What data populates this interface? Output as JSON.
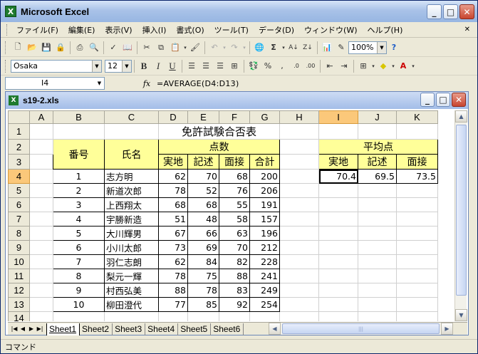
{
  "app": {
    "title": "Microsoft Excel",
    "file_name": "s19-2.xls"
  },
  "menu": {
    "items": [
      "ファイル(F)",
      "編集(E)",
      "表示(V)",
      "挿入(I)",
      "書式(O)",
      "ツール(T)",
      "データ(D)",
      "ウィンドウ(W)",
      "ヘルプ(H)"
    ]
  },
  "toolbar": {
    "zoom": "100%",
    "font_name": "Osaka",
    "font_size": "12"
  },
  "formula_bar": {
    "name_box": "I4",
    "fx_label": "fx",
    "formula": "=AVERAGE(D4:D13)"
  },
  "sheet": {
    "columns": [
      "A",
      "B",
      "C",
      "D",
      "E",
      "F",
      "G",
      "H",
      "I",
      "J",
      "K"
    ],
    "selected_column": "I",
    "selected_row": "4",
    "row_numbers": [
      "1",
      "2",
      "3",
      "4",
      "5",
      "6",
      "7",
      "8",
      "9",
      "10",
      "11",
      "12",
      "13",
      "14"
    ],
    "title": "免許試験合否表",
    "headers": {
      "number": "番号",
      "name": "氏名",
      "points": "点数",
      "practical": "実地",
      "written": "記述",
      "interview": "面接",
      "total": "合計"
    },
    "rows": [
      {
        "no": "1",
        "name": "志方明",
        "practical": "62",
        "written": "70",
        "interview": "68",
        "total": "200"
      },
      {
        "no": "2",
        "name": "新道次郎",
        "practical": "78",
        "written": "52",
        "interview": "76",
        "total": "206"
      },
      {
        "no": "3",
        "name": "上西翔太",
        "practical": "68",
        "written": "68",
        "interview": "55",
        "total": "191"
      },
      {
        "no": "4",
        "name": "宇勝新造",
        "practical": "51",
        "written": "48",
        "interview": "58",
        "total": "157"
      },
      {
        "no": "5",
        "name": "大川輝男",
        "practical": "67",
        "written": "66",
        "interview": "63",
        "total": "196"
      },
      {
        "no": "6",
        "name": "小川太郎",
        "practical": "73",
        "written": "69",
        "interview": "70",
        "total": "212"
      },
      {
        "no": "7",
        "name": "羽仁志朗",
        "practical": "62",
        "written": "84",
        "interview": "82",
        "total": "228"
      },
      {
        "no": "8",
        "name": "梨元一輝",
        "practical": "78",
        "written": "75",
        "interview": "88",
        "total": "241"
      },
      {
        "no": "9",
        "name": "村西弘美",
        "practical": "88",
        "written": "78",
        "interview": "83",
        "total": "249"
      },
      {
        "no": "10",
        "name": "柳田澄代",
        "practical": "77",
        "written": "85",
        "interview": "92",
        "total": "254"
      }
    ],
    "average": {
      "title": "平均点",
      "practical_label": "実地",
      "written_label": "記述",
      "interview_label": "面接",
      "practical": "70.4",
      "written": "69.5",
      "interview": "73.5"
    }
  },
  "tabs": [
    "Sheet1",
    "Sheet2",
    "Sheet3",
    "Sheet4",
    "Sheet5",
    "Sheet6"
  ],
  "active_tab": "Sheet1",
  "status": {
    "mode": "コマンド"
  },
  "colors": {
    "header_fill": "#ffff99",
    "selected_header": "#fbc87a"
  }
}
